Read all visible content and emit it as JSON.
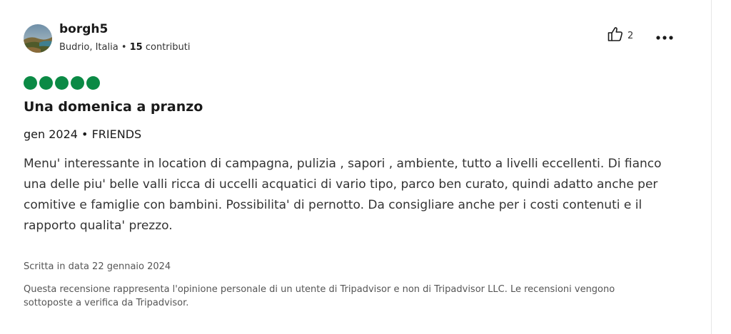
{
  "review": {
    "user": {
      "name": "borgh5",
      "location": "Budrio, Italia",
      "separator": "•",
      "contributions_count": "15",
      "contributions_label": "contributi"
    },
    "helpful": {
      "count": "2",
      "icon": "thumbs-up-icon"
    },
    "more_icon": "more-options-icon",
    "rating": {
      "value": 5,
      "max": 5,
      "color": "#0b8a45"
    },
    "title": "Una domenica a pranzo",
    "trip": {
      "date": "gen 2024",
      "separator": "•",
      "type": "FRIENDS"
    },
    "body": "Menu' interessante in location di campagna, pulizia , sapori , ambiente, tutto a livelli eccellenti. Di fianco una delle piu' belle valli ricca di uccelli acquatici di vario tipo, parco ben curato, quindi adatto anche per comitive e famiglie con bambini. Possibilita' di pernotto. Da consigliare anche per i costi contenuti e il rapporto qualita' prezzo.",
    "written_date": "Scritta in data 22 gennaio 2024",
    "disclaimer": "Questa recensione rappresenta l'opinione personale di un utente di Tripadvisor e non di Tripadvisor LLC. Le recensioni vengono sottoposte a verifica da Tripadvisor."
  }
}
